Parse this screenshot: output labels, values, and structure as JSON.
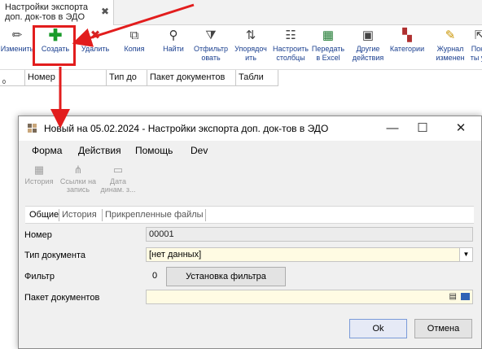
{
  "main": {
    "tab_title": "Настройки экспорта доп. док-тов в ЭДО",
    "tab_close": "✖",
    "toolbar": [
      {
        "id": "edit",
        "label": "Изменить",
        "icon": "pencil-icon",
        "glyph": "✏"
      },
      {
        "id": "create",
        "label": "Создать",
        "icon": "plus-icon",
        "glyph": "✚"
      },
      {
        "id": "delete",
        "label": "Удалить",
        "icon": "delete-x-icon",
        "glyph": "✖"
      },
      {
        "id": "copy",
        "label": "Копия",
        "icon": "copy-icon",
        "glyph": "⧉"
      },
      {
        "id": "find",
        "label": "Найти",
        "icon": "binoculars-icon",
        "glyph": "⚲"
      },
      {
        "id": "filter",
        "label": "Отфильтр\nовать",
        "icon": "filter-icon",
        "glyph": "⧩"
      },
      {
        "id": "sort",
        "label": "Упорядоч\nить",
        "icon": "sort-icon",
        "glyph": "⇅"
      },
      {
        "id": "columns",
        "label": "Настроить\nстолбцы",
        "icon": "columns-icon",
        "glyph": "☷"
      },
      {
        "id": "excel",
        "label": "Передать\nв Excel",
        "icon": "excel-icon",
        "glyph": "▦"
      },
      {
        "id": "other",
        "label": "Другие\nдействия",
        "icon": "briefcase-icon",
        "glyph": "▣"
      },
      {
        "id": "categories",
        "label": "Категории",
        "icon": "categories-icon",
        "glyph": "▚"
      },
      {
        "id": "journal",
        "label": "Журнал\nизменен",
        "icon": "journal-icon",
        "glyph": "✎"
      },
      {
        "id": "show",
        "label": "Пока\nты уд",
        "icon": "show-icon",
        "glyph": "⇱"
      }
    ],
    "grid_columns": [
      "0",
      "Номер",
      "Тип до",
      "Пакет документов",
      "Табли"
    ]
  },
  "dialog": {
    "title": "Новый на 05.02.2024 - Настройки экспорта доп. док-тов в ЭДО",
    "window_buttons": {
      "minimize": "—",
      "maximize": "☐",
      "close": "✕"
    },
    "menu": [
      "Форма",
      "Действия",
      "Помощь",
      "Dev"
    ],
    "toolbar": [
      {
        "label": "История",
        "icon": "history-icon",
        "glyph": "▦"
      },
      {
        "label": "Ссылки на\nзапись",
        "icon": "links-tree-icon",
        "glyph": "⋔"
      },
      {
        "label": "Дата\nдинам. з...",
        "icon": "folder-date-icon",
        "glyph": "▭"
      }
    ],
    "tabs": [
      "Общие",
      "История",
      "Прикрепленные файлы"
    ],
    "fields": {
      "number_label": "Номер",
      "number_value": "00001",
      "doctype_label": "Тип документа",
      "doctype_value": "[нет данных]",
      "filter_label": "Фильтр",
      "filter_value": "0",
      "filter_button": "Установка фильтра",
      "package_label": "Пакет документов",
      "package_value": ""
    },
    "ok_label": "Ok",
    "cancel_label": "Отмена"
  },
  "colors": {
    "highlight_red": "#e21d1d",
    "create_icon_green": "#1a9b2b",
    "delete_icon_red": "#d42525",
    "required_field_bg": "#fffbe3"
  }
}
